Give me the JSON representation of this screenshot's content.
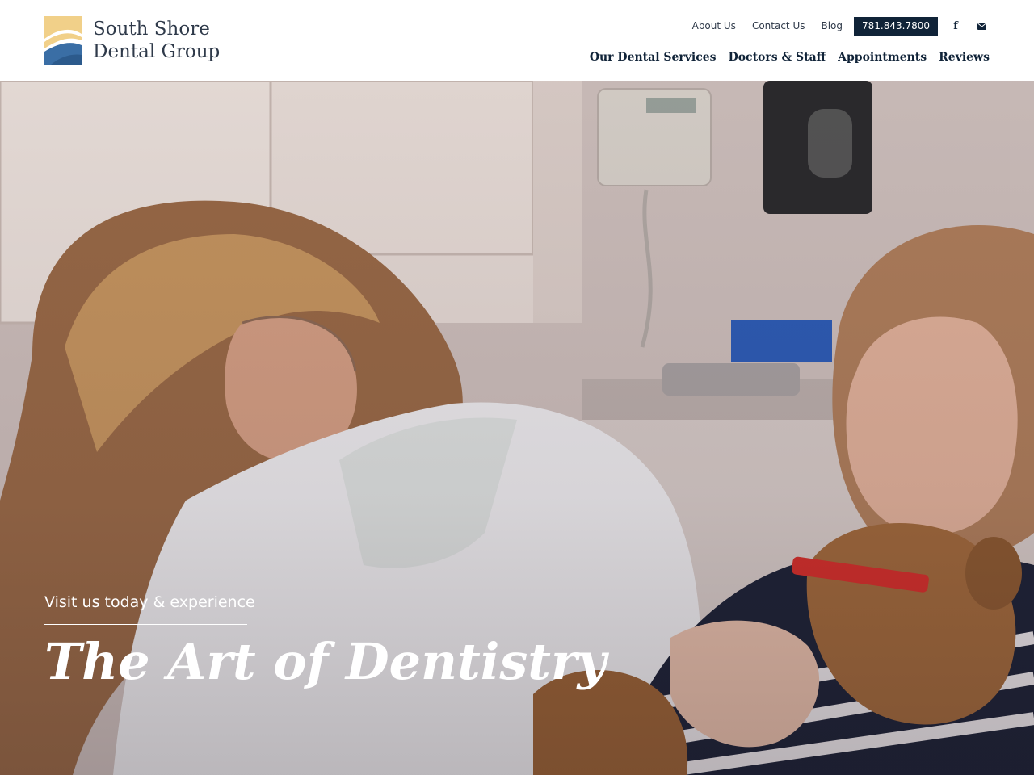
{
  "brand": {
    "line1": "South Shore",
    "line2": "Dental Group",
    "colors": {
      "navy": "#102338",
      "logo_gold": "#f1d089",
      "logo_blue": "#3a6ea5"
    }
  },
  "utility_nav": {
    "about": "About Us",
    "contact": "Contact Us",
    "blog": "Blog",
    "phone": "781.843.7800",
    "facebook_icon": "f",
    "email_icon": "envelope-icon"
  },
  "main_nav": [
    "Our Dental Services",
    "Doctors & Staff",
    "Appointments",
    "Reviews"
  ],
  "hero": {
    "kicker": "Visit us today & experience",
    "title": "The Art of Dentistry"
  }
}
